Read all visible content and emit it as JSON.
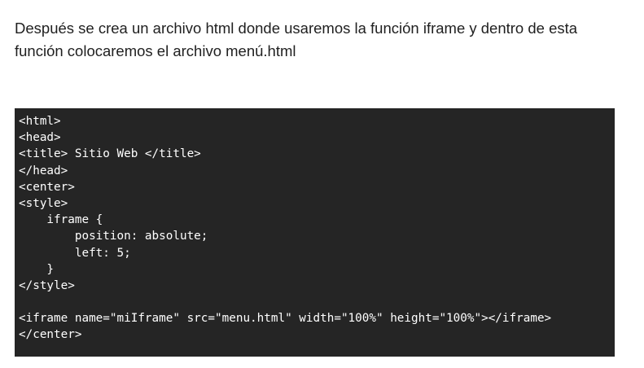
{
  "intro": {
    "text": "Después se crea un archivo html donde usaremos la función iframe y dentro de esta función colocaremos el archivo menú.html"
  },
  "code": {
    "lines": [
      "<html>",
      "<head>",
      "<title> Sitio Web </title>",
      "</head>",
      "<center>",
      "<style>",
      "    iframe {",
      "        position: absolute;",
      "        left: 5;",
      "    }",
      "</style>",
      "",
      "<iframe name=\"miIframe\" src=\"menu.html\" width=\"100%\" height=\"100%\"></iframe>",
      "</center>"
    ]
  }
}
